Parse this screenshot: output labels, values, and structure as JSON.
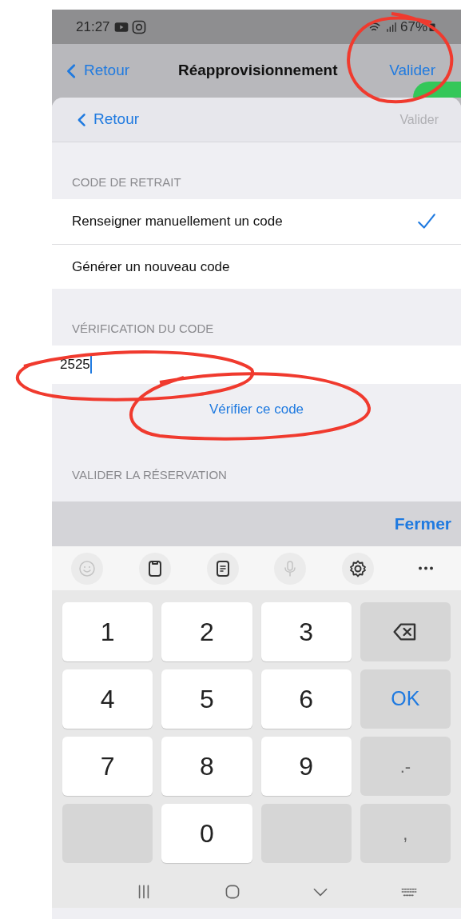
{
  "status_bar": {
    "time": "21:27",
    "battery": "67%"
  },
  "nav_bar": {
    "back": "Retour",
    "title": "Réapprovisionnement",
    "action": "Valider",
    "toggle": {
      "on": true
    }
  },
  "sheet": {
    "back": "Retour",
    "action": {
      "label": "Valider",
      "disabled": true
    }
  },
  "sections": [
    {
      "kind": "options",
      "header": "CODE DE RETRAIT",
      "options": [
        {
          "label": "Renseigner manuellement un code",
          "selected": true
        },
        {
          "label": "Générer un nouveau code",
          "selected": false
        }
      ]
    },
    {
      "kind": "input",
      "header": "VÉRIFICATION DU CODE",
      "value": "2525",
      "link": "Vérifier ce code"
    },
    {
      "kind": "header",
      "header": "VALIDER LA RÉSERVATION"
    }
  ],
  "keyboard": {
    "close": "Fermer",
    "toolbar": [
      {
        "kind": "emoji",
        "disabled": true
      },
      {
        "kind": "clipboard",
        "disabled": false
      },
      {
        "kind": "document",
        "disabled": false
      },
      {
        "kind": "mic",
        "disabled": true
      },
      {
        "kind": "settings",
        "disabled": false
      },
      {
        "kind": "more",
        "disabled": false
      }
    ],
    "keys": [
      {
        "kind": "digit",
        "label": "1"
      },
      {
        "kind": "digit",
        "label": "2"
      },
      {
        "kind": "digit",
        "label": "3"
      },
      {
        "kind": "backspace"
      },
      {
        "kind": "digit",
        "label": "4"
      },
      {
        "kind": "digit",
        "label": "5"
      },
      {
        "kind": "digit",
        "label": "6"
      },
      {
        "kind": "action",
        "label": "OK"
      },
      {
        "kind": "digit",
        "label": "7"
      },
      {
        "kind": "digit",
        "label": "8"
      },
      {
        "kind": "digit",
        "label": "9"
      },
      {
        "kind": "symbol",
        "label": ".-"
      },
      {
        "kind": "blank"
      },
      {
        "kind": "digit",
        "label": "0"
      },
      {
        "kind": "blank"
      },
      {
        "kind": "symbol",
        "label": ","
      }
    ]
  }
}
